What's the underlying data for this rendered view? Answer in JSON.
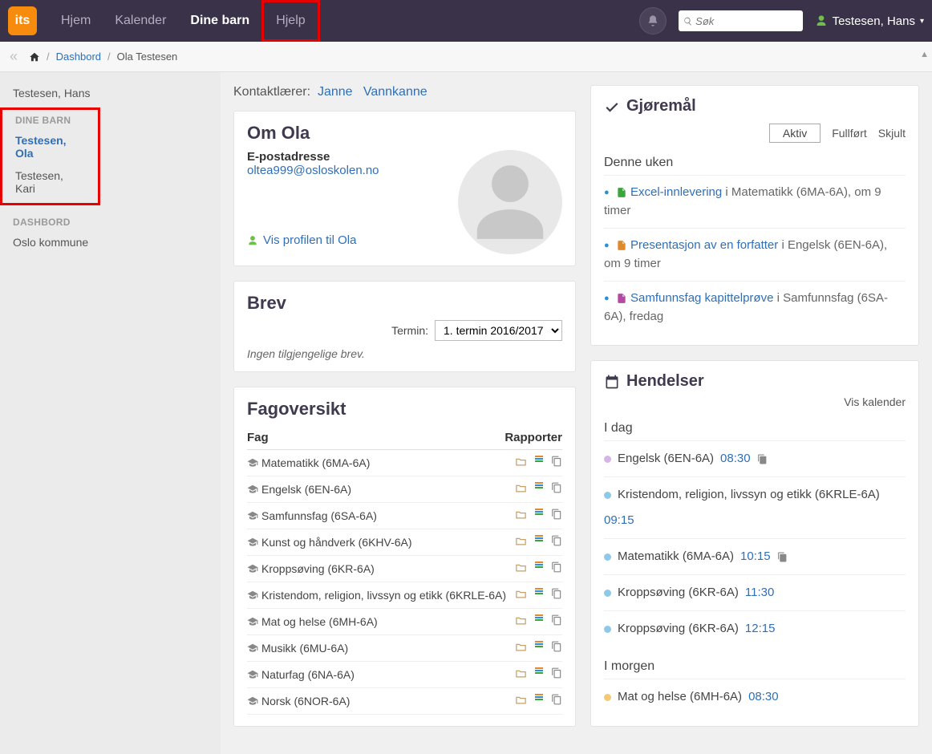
{
  "nav": {
    "logo": "its",
    "items": [
      {
        "label": "Hjem",
        "active": false,
        "highlight": false
      },
      {
        "label": "Kalender",
        "active": false,
        "highlight": false
      },
      {
        "label": "Dine barn",
        "active": true,
        "highlight": false
      },
      {
        "label": "Hjelp",
        "active": false,
        "highlight": true
      }
    ],
    "search_placeholder": "Søk",
    "user_name": "Testesen, Hans"
  },
  "breadcrumb": {
    "dash": "Dashbord",
    "current": "Ola Testesen"
  },
  "sidebar": {
    "user": "Testesen, Hans",
    "dine_barn_heading": "DINE BARN",
    "children": [
      {
        "name": "Testesen, Ola",
        "active": true
      },
      {
        "name": "Testesen, Kari",
        "active": false
      }
    ],
    "dashbord_heading": "DASHBORD",
    "dash_items": [
      "Oslo kommune"
    ]
  },
  "contact": {
    "label": "Kontaktlærer:",
    "names": [
      "Janne",
      "Vannkanne"
    ]
  },
  "about": {
    "title": "Om Ola",
    "email_label": "E-postadresse",
    "email": "oltea999@osloskolen.no",
    "profile_link": "Vis profilen til Ola"
  },
  "letters": {
    "title": "Brev",
    "term_label": "Termin:",
    "term_value": "1. termin 2016/2017",
    "none": "Ingen tilgjengelige brev."
  },
  "subjects": {
    "title": "Fagoversikt",
    "col_subject": "Fag",
    "col_reports": "Rapporter",
    "rows": [
      "Matematikk (6MA-6A)",
      "Engelsk (6EN-6A)",
      "Samfunnsfag (6SA-6A)",
      "Kunst og håndverk (6KHV-6A)",
      "Kroppsøving (6KR-6A)",
      "Kristendom, religion, livssyn og etikk (6KRLE-6A)",
      "Mat og helse (6MH-6A)",
      "Musikk (6MU-6A)",
      "Naturfag (6NA-6A)",
      "Norsk (6NOR-6A)"
    ]
  },
  "tasks": {
    "title": "Gjøremål",
    "tabs": {
      "active": "Aktiv",
      "done": "Fullført",
      "hidden": "Skjult"
    },
    "week_heading": "Denne uken",
    "items": [
      {
        "link": "Excel-innlevering",
        "sep": "i",
        "course": "Matematikk (6MA-6A)",
        "when": ", om 9 timer",
        "icon_color": "#3aa53a"
      },
      {
        "link": "Presentasjon av en forfatter",
        "sep": "i",
        "course": "Engelsk (6EN-6A)",
        "when": ", om 9 timer",
        "icon_color": "#e08a2e"
      },
      {
        "link": "Samfunnsfag kapittelprøve",
        "sep": "i",
        "course": "Samfunnsfag (6SA-6A)",
        "when": ", fredag",
        "icon_color": "#b24aa3"
      }
    ]
  },
  "events": {
    "title": "Hendelser",
    "show_calendar": "Vis kalender",
    "today_heading": "I dag",
    "tomorrow_heading": "I morgen",
    "today": [
      {
        "name": "Engelsk (6EN-6A)",
        "time": "08:30",
        "dot": "#d7b4e6",
        "copy": true
      },
      {
        "name": "Kristendom, religion, livssyn og etikk (6KRLE-6A)",
        "time": "09:15",
        "dot": "#8fc9e8"
      },
      {
        "name": "Matematikk (6MA-6A)",
        "time": "10:15",
        "dot": "#8fc9e8",
        "copy": true
      },
      {
        "name": "Kroppsøving (6KR-6A)",
        "time": "11:30",
        "dot": "#8fc9e8"
      },
      {
        "name": "Kroppsøving (6KR-6A)",
        "time": "12:15",
        "dot": "#8fc9e8"
      }
    ],
    "tomorrow": [
      {
        "name": "Mat og helse (6MH-6A)",
        "time": "08:30",
        "dot": "#f3c978"
      }
    ]
  }
}
